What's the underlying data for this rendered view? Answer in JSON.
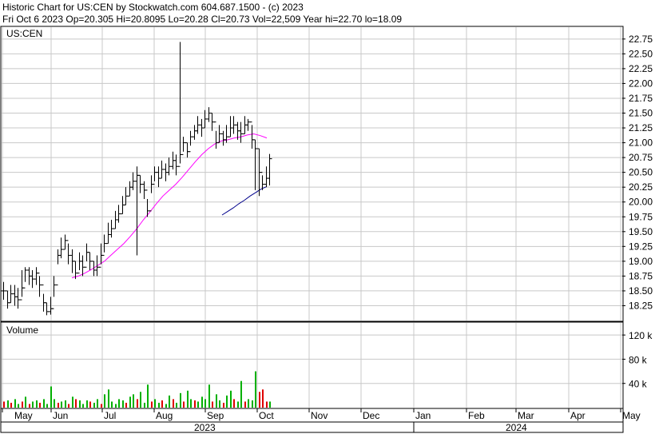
{
  "header": {
    "line1": "Historic Chart for US:CEN by Stockwatch.com 604.687.1500 - (c) 2023",
    "line2": "Fri Oct  6 2023  Op=20.305  Hi=20.8095  Lo=20.28  Cl=20.73  Vol=22,509  Year hi=22.70  lo=18.09"
  },
  "colors": {
    "grid": "#c8c8c8",
    "price_bar": "#000000",
    "ma_short": "#ff00ff",
    "ma_long": "#00008b",
    "volume_up": "#00b000",
    "volume_down": "#e00000",
    "border": "#000000"
  },
  "chart_data": [
    {
      "type": "line",
      "panel": "price",
      "title": "US:CEN",
      "ylim": [
        18.0,
        22.95
      ],
      "y_ticks": [
        "22.75",
        "22.50",
        "22.25",
        "22.00",
        "21.75",
        "21.50",
        "21.25",
        "21.00",
        "20.75",
        "20.50",
        "20.25",
        "20.00",
        "19.75",
        "19.50",
        "19.25",
        "19.00",
        "18.75",
        "18.50",
        "18.25"
      ],
      "x_ticks": [
        "May",
        "Jun",
        "Jul",
        "Aug",
        "Sep",
        "Oct",
        "Nov",
        "Dec",
        "Jan",
        "Feb",
        "Mar",
        "Apr",
        "May"
      ],
      "x_years": [
        "2023",
        "2024"
      ],
      "grid": true,
      "ohlc_close": [
        18.5,
        18.3,
        18.45,
        18.4,
        18.35,
        18.55,
        18.85,
        18.75,
        18.7,
        18.8,
        18.6,
        18.3,
        18.15,
        18.2,
        18.6,
        19.1,
        19.2,
        19.35,
        19.1,
        19.0,
        18.8,
        19.0,
        18.9,
        19.15,
        19.0,
        18.85,
        18.9,
        19.1,
        19.3,
        19.45,
        19.55,
        19.7,
        19.8,
        19.95,
        20.1,
        20.25,
        20.35,
        20.45,
        20.3,
        20.2,
        19.85,
        20.3,
        20.5,
        20.4,
        20.55,
        20.5,
        20.6,
        20.7,
        20.6,
        20.8,
        21.0,
        20.85,
        21.1,
        21.2,
        21.3,
        21.25,
        21.4,
        21.5,
        21.35,
        21.0,
        21.15,
        21.05,
        21.1,
        21.25,
        21.3,
        21.2,
        21.15,
        21.3,
        21.35,
        21.05,
        20.9,
        20.5,
        20.3,
        20.4,
        20.73
      ],
      "ohlc_high": [
        18.65,
        18.5,
        18.6,
        18.6,
        18.55,
        18.85,
        18.9,
        18.9,
        18.85,
        18.9,
        18.75,
        18.45,
        18.3,
        18.4,
        18.75,
        19.2,
        19.4,
        19.45,
        19.3,
        19.2,
        19.0,
        19.15,
        19.1,
        19.3,
        19.15,
        19.0,
        19.1,
        19.3,
        19.45,
        19.65,
        19.7,
        19.85,
        19.95,
        20.1,
        20.25,
        20.35,
        20.5,
        20.6,
        20.45,
        20.35,
        20.05,
        20.45,
        20.6,
        20.6,
        20.7,
        20.65,
        20.75,
        20.85,
        20.8,
        22.7,
        21.1,
        21.0,
        21.2,
        21.3,
        21.45,
        21.4,
        21.55,
        21.6,
        21.5,
        21.2,
        21.3,
        21.2,
        21.3,
        21.45,
        21.45,
        21.35,
        21.35,
        21.45,
        21.4,
        21.3,
        21.05,
        20.9,
        20.45,
        20.6,
        20.81
      ],
      "ohlc_low": [
        18.35,
        18.2,
        18.3,
        18.25,
        18.2,
        18.4,
        18.65,
        18.6,
        18.55,
        18.6,
        18.4,
        18.15,
        18.09,
        18.1,
        18.4,
        18.95,
        19.05,
        19.2,
        18.95,
        18.8,
        18.7,
        18.85,
        18.75,
        19.0,
        18.85,
        18.75,
        18.75,
        18.95,
        19.15,
        19.3,
        19.4,
        19.55,
        19.65,
        19.8,
        19.95,
        20.1,
        20.2,
        19.1,
        20.15,
        20.05,
        19.75,
        20.15,
        20.35,
        20.25,
        20.4,
        20.35,
        20.45,
        20.55,
        20.45,
        20.65,
        20.85,
        20.75,
        20.95,
        21.05,
        21.15,
        21.1,
        21.25,
        21.35,
        21.2,
        20.9,
        21.0,
        20.95,
        21.0,
        21.1,
        21.15,
        21.05,
        21.0,
        21.15,
        21.2,
        20.9,
        20.2,
        20.1,
        20.2,
        20.25,
        20.28
      ],
      "ma_short_values": [
        18.72,
        18.75,
        18.8,
        18.86,
        18.93,
        19.0,
        19.1,
        19.2,
        19.3,
        19.42,
        19.55,
        19.7,
        19.83,
        19.97,
        20.1,
        20.2,
        20.3,
        20.42,
        20.55,
        20.68,
        20.8,
        20.9,
        20.98,
        21.03,
        21.05,
        21.08,
        21.1,
        21.13,
        21.15,
        21.12,
        21.08
      ],
      "ma_long_values": [
        19.78,
        19.84,
        19.9,
        19.97,
        20.03,
        20.1,
        20.16,
        20.22,
        20.26
      ],
      "series": [
        {
          "name": "",
          "values": []
        }
      ]
    },
    {
      "type": "bar",
      "panel": "volume",
      "title": "Volume",
      "ylim": [
        0,
        140
      ],
      "y_ticks": [
        "120 k",
        "80 k",
        "40 k"
      ],
      "up_values": [
        10,
        12,
        8,
        14,
        6,
        10,
        18,
        6,
        10,
        12,
        8,
        14,
        6,
        35,
        14,
        8,
        10,
        12,
        6,
        18,
        14,
        12,
        6,
        12,
        10,
        8,
        14,
        6,
        22,
        30,
        10,
        6,
        14,
        12,
        8,
        18,
        22,
        14,
        26,
        8,
        38,
        10,
        14,
        8,
        12,
        6,
        20,
        14,
        8,
        24,
        10,
        28,
        14,
        12,
        10,
        18,
        14,
        38,
        10,
        22,
        12,
        8,
        20,
        28,
        14,
        10,
        44,
        10,
        14,
        12,
        60,
        26,
        30,
        10,
        10
      ],
      "down_flags": [
        1,
        0,
        1,
        0,
        0,
        1,
        0,
        1,
        0,
        0,
        1,
        0,
        0,
        0,
        0,
        1,
        0,
        0,
        1,
        0,
        1,
        0,
        0,
        0,
        1,
        0,
        0,
        1,
        0,
        0,
        0,
        0,
        0,
        0,
        1,
        0,
        0,
        1,
        0,
        0,
        0,
        1,
        0,
        0,
        1,
        0,
        0,
        1,
        0,
        0,
        1,
        0,
        0,
        1,
        0,
        0,
        0,
        0,
        1,
        0,
        0,
        1,
        0,
        0,
        1,
        0,
        0,
        1,
        0,
        0,
        0,
        1,
        1,
        1,
        0
      ]
    }
  ]
}
